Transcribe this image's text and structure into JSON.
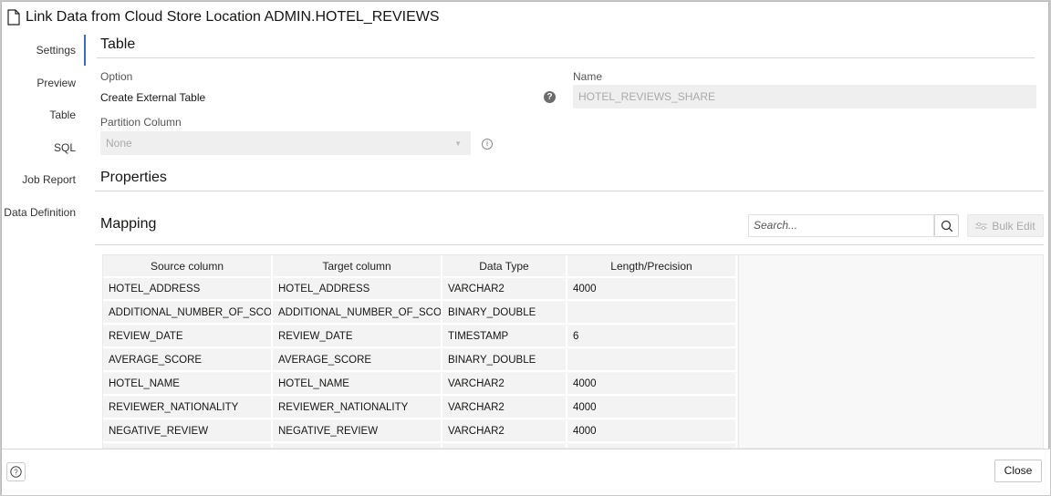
{
  "title": "Link Data from Cloud Store Location ADMIN.HOTEL_REVIEWS",
  "sidebar": {
    "items": [
      {
        "label": "Settings",
        "active": true
      },
      {
        "label": "Preview"
      },
      {
        "label": "Table"
      },
      {
        "label": "SQL"
      },
      {
        "label": "Job Report"
      },
      {
        "label": "Data Definition"
      }
    ]
  },
  "table_section": {
    "heading": "Table",
    "option_label": "Option",
    "option_value": "Create External Table",
    "name_label": "Name",
    "name_value": "HOTEL_REVIEWS_SHARE",
    "partition_label": "Partition Column",
    "partition_value": "None"
  },
  "properties": {
    "heading": "Properties"
  },
  "mapping": {
    "heading": "Mapping",
    "search_placeholder": "Search...",
    "bulk_edit": "Bulk Edit",
    "columns": [
      "Source column",
      "Target column",
      "Data Type",
      "Length/Precision"
    ],
    "rows": [
      [
        "HOTEL_ADDRESS",
        "HOTEL_ADDRESS",
        "VARCHAR2",
        "4000"
      ],
      [
        "ADDITIONAL_NUMBER_OF_SCORING",
        "ADDITIONAL_NUMBER_OF_SCORING",
        "BINARY_DOUBLE",
        ""
      ],
      [
        "REVIEW_DATE",
        "REVIEW_DATE",
        "TIMESTAMP",
        "6"
      ],
      [
        "AVERAGE_SCORE",
        "AVERAGE_SCORE",
        "BINARY_DOUBLE",
        ""
      ],
      [
        "HOTEL_NAME",
        "HOTEL_NAME",
        "VARCHAR2",
        "4000"
      ],
      [
        "REVIEWER_NATIONALITY",
        "REVIEWER_NATIONALITY",
        "VARCHAR2",
        "4000"
      ],
      [
        "NEGATIVE_REVIEW",
        "NEGATIVE_REVIEW",
        "VARCHAR2",
        "4000"
      ]
    ]
  },
  "footer": {
    "close": "Close"
  }
}
